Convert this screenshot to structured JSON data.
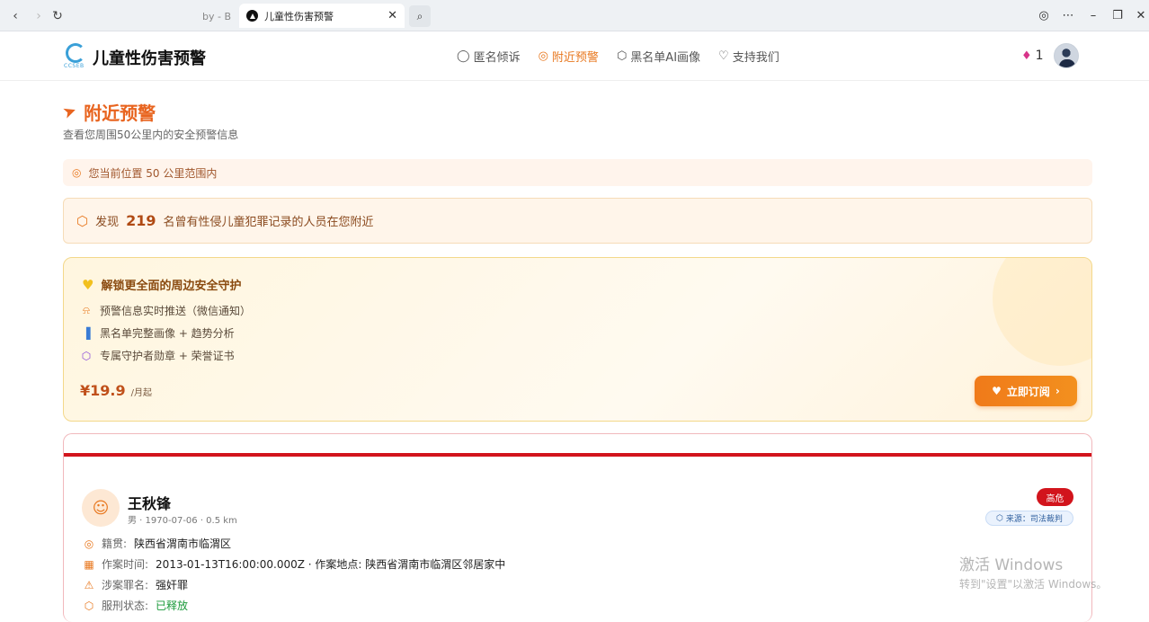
{
  "browser": {
    "prev_tab_fragment": "by - B",
    "active_tab_title": "儿童性伤害预警"
  },
  "header": {
    "site_title": "儿童性伤害预警",
    "logo_text": "CCSEB",
    "nav": [
      {
        "label": "匿名倾诉",
        "icon": "chat-icon"
      },
      {
        "label": "附近预警",
        "icon": "location-pin-icon",
        "active": true
      },
      {
        "label": "黑名单AI画像",
        "icon": "shield-icon"
      },
      {
        "label": "支持我们",
        "icon": "heart-icon"
      }
    ],
    "points": "1"
  },
  "page": {
    "title": "附近预警",
    "subtitle": "查看您周围50公里内的安全预警信息",
    "location_text": "您当前位置 50 公里范围内",
    "found_prefix": "发现",
    "found_count": "219",
    "found_suffix": "名曾有性侵儿童犯罪记录的人员在您附近"
  },
  "promo": {
    "title": "解锁更全面的周边安全守护",
    "features": [
      {
        "text": "预警信息实时推送（微信通知）",
        "icon": "bell-icon",
        "color": "#e8781f"
      },
      {
        "text": "黑名单完整画像 + 趋势分析",
        "icon": "bar-chart-icon",
        "color": "#3a7bd5"
      },
      {
        "text": "专属守护者勋章 + 荣誉证书",
        "icon": "shield-icon",
        "color": "#8a4ad8"
      }
    ],
    "price": "¥19.9",
    "price_unit": "/月起",
    "button_label": "立即订阅"
  },
  "offender": {
    "name": "王秋锋",
    "meta": "男 · 1970-07-06 · 0.5 km",
    "risk": "高危",
    "source": "来源：司法裁判",
    "details": [
      {
        "label": "籍贯:",
        "value": "陕西省渭南市临渭区",
        "icon": "location-pin-icon"
      },
      {
        "label": "作案时间:",
        "value": "2013-01-13T16:00:00.000Z · 作案地点: 陕西省渭南市临渭区邻居家中",
        "icon": "calendar-icon"
      },
      {
        "label": "涉案罪名:",
        "value": "强奸罪",
        "icon": "warning-icon"
      },
      {
        "label": "服刑状态:",
        "value": "已释放",
        "icon": "shield-icon"
      }
    ]
  },
  "watermark": {
    "line1": "激活 Windows",
    "line2": "转到\"设置\"以激活 Windows。"
  }
}
